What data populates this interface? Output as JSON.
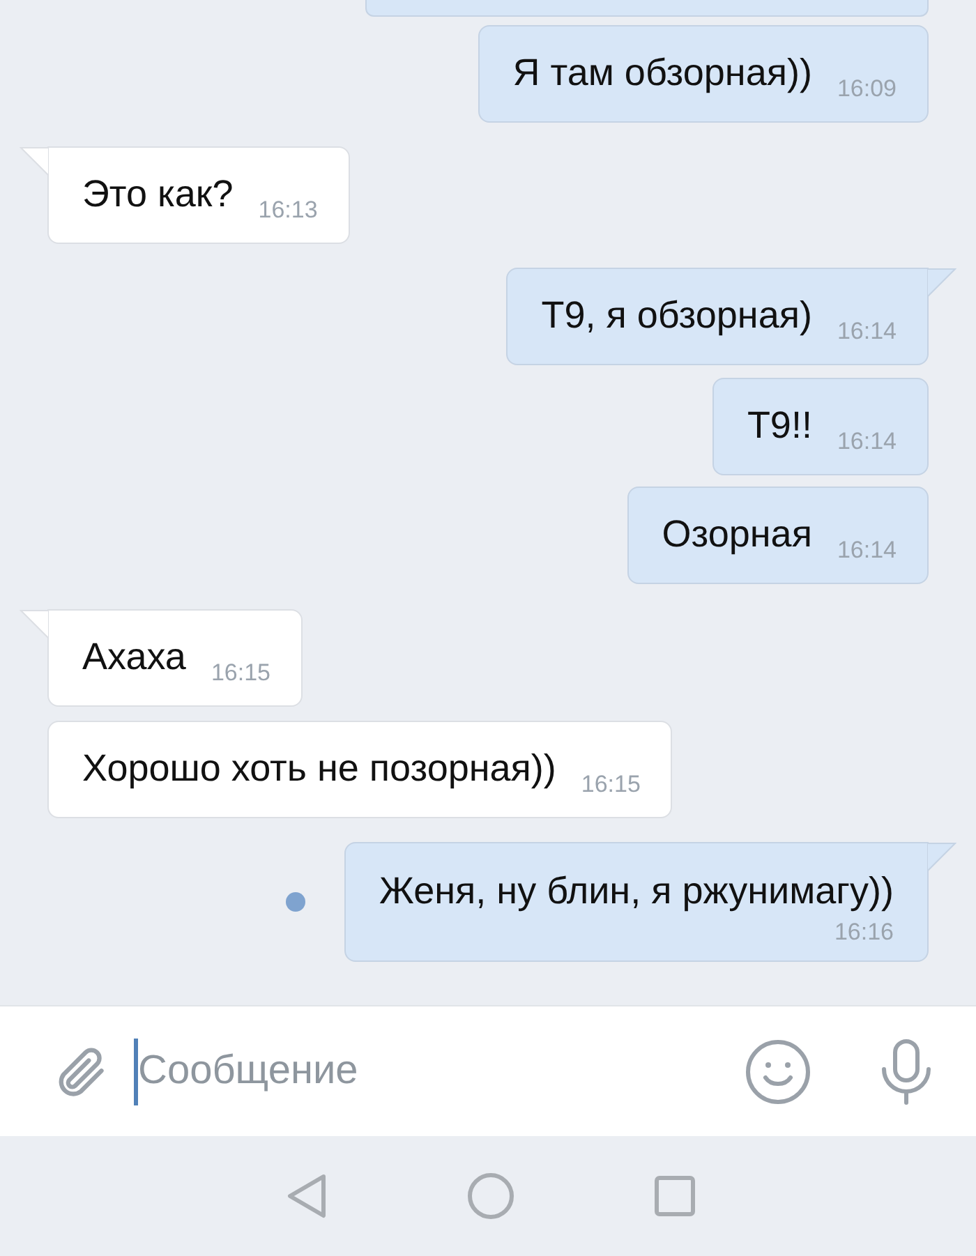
{
  "messages": [
    {
      "outgoing": true,
      "text": "Я там обзорная))",
      "time": "16:09",
      "tail": false,
      "kind": "inline",
      "unread": false
    },
    {
      "outgoing": false,
      "text": "Это как?",
      "time": "16:13",
      "tail": true,
      "kind": "inline",
      "unread": false
    },
    {
      "outgoing": true,
      "text": "Т9, я обзорная)",
      "time": "16:14",
      "tail": true,
      "kind": "inline",
      "unread": false
    },
    {
      "outgoing": true,
      "text": "Т9!!",
      "time": "16:14",
      "tail": false,
      "kind": "inline",
      "unread": false
    },
    {
      "outgoing": true,
      "text": "Озорная",
      "time": "16:14",
      "tail": false,
      "kind": "inline",
      "unread": false
    },
    {
      "outgoing": false,
      "text": "Ахаха",
      "time": "16:15",
      "tail": true,
      "kind": "inline",
      "unread": false
    },
    {
      "outgoing": false,
      "text": "Хорошо хоть не позорная))",
      "time": "16:15",
      "tail": false,
      "kind": "inline",
      "unread": false
    },
    {
      "outgoing": true,
      "text": "Женя, ну блин, я ржунимагу))",
      "time": "16:16",
      "tail": true,
      "kind": "stacked",
      "unread": true
    }
  ],
  "composer": {
    "placeholder": "Сообщение"
  }
}
